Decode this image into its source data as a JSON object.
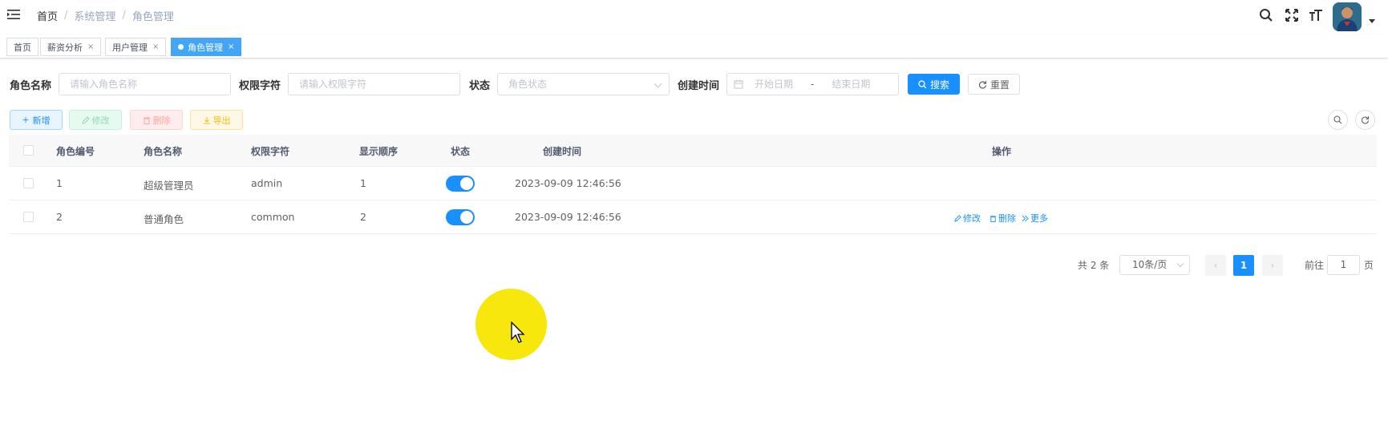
{
  "navbar": {
    "breadcrumb": [
      "首页",
      "系统管理",
      "角色管理"
    ],
    "separator": "/",
    "icons": [
      "search-icon",
      "fullscreen-icon",
      "font-size-icon"
    ]
  },
  "tags": [
    {
      "label": "首页",
      "closable": false,
      "active": false
    },
    {
      "label": "薪资分析",
      "closable": true,
      "active": false
    },
    {
      "label": "用户管理",
      "closable": true,
      "active": false
    },
    {
      "label": "角色管理",
      "closable": true,
      "active": true
    }
  ],
  "tag_close": "×",
  "search": {
    "role_name_label": "角色名称",
    "role_name_placeholder": "请输入角色名称",
    "role_key_label": "权限字符",
    "role_key_placeholder": "请输入权限字符",
    "status_label": "状态",
    "status_placeholder": "角色状态",
    "created_label": "创建时间",
    "start_placeholder": "开始日期",
    "range_sep": "-",
    "end_placeholder": "结束日期",
    "search_btn": "搜索",
    "reset_btn": "重置"
  },
  "toolbar": {
    "add": "新增",
    "edit": "修改",
    "delete": "删除",
    "export": "导出"
  },
  "table": {
    "columns": [
      "角色编号",
      "角色名称",
      "权限字符",
      "显示顺序",
      "状态",
      "创建时间",
      "操作"
    ],
    "rows": [
      {
        "id": "1",
        "name": "超级管理员",
        "key": "admin",
        "sort": "1",
        "enabled": true,
        "created": "2023-09-09 12:46:56",
        "ops": []
      },
      {
        "id": "2",
        "name": "普通角色",
        "key": "common",
        "sort": "2",
        "enabled": true,
        "created": "2023-09-09 12:46:56",
        "ops": [
          "修改",
          "删除",
          "更多"
        ]
      }
    ]
  },
  "pagination": {
    "total_text": "共 2 条",
    "page_size": "10条/页",
    "current_page": "1",
    "goto_label": "前往",
    "goto_value": "1",
    "page_unit": "页"
  },
  "colors": {
    "primary": "#1890ff",
    "active_tag": "#42a5f5",
    "cursor_highlight": "#f7e70c"
  }
}
